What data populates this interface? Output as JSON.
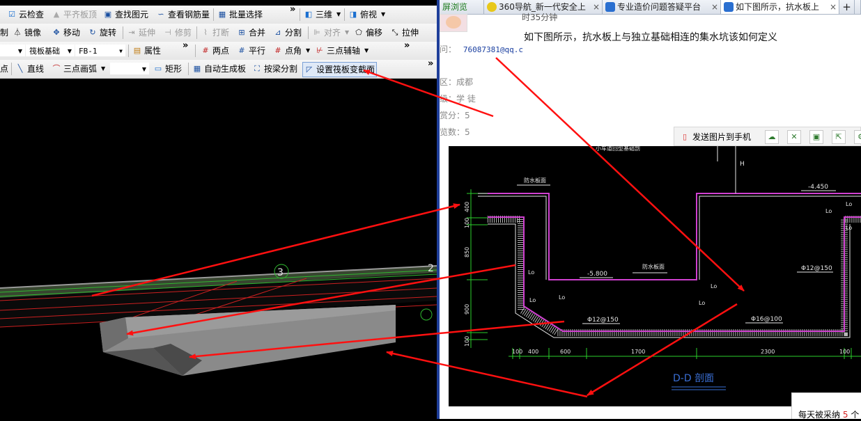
{
  "left_app": {
    "toolbar1": {
      "cloud_check": "云检查",
      "align_top": "平齐板顶",
      "find_element": "查找图元",
      "view_rebar": "查看钢筋量",
      "batch_select": "批量选择",
      "three_d": "三维",
      "top_view": "俯视"
    },
    "toolbar2": {
      "copy_partial": "制",
      "mirror": "镜像",
      "move": "移动",
      "rotate": "旋转",
      "extend": "延伸",
      "trim": "修剪",
      "break": "打断",
      "merge": "合并",
      "split": "分割",
      "align": "对齐",
      "offset": "偏移",
      "stretch": "拉伸"
    },
    "toolbar3": {
      "category_value": "筏板基础",
      "element_value": "FB-1",
      "properties": "属性",
      "two_points": "两点",
      "parallel": "平行",
      "point_angle": "点角",
      "three_point_axis": "三点辅轴"
    },
    "toolbar4": {
      "point_partial": "点",
      "line": "直线",
      "three_point_arc": "三点画弧",
      "rectangle": "矩形",
      "auto_generate": "自动生成板",
      "split_by_beam": "按梁分割",
      "set_slope": "设置筏板变截面"
    },
    "viewport": {
      "axis_label_3": "3",
      "axis_label_2": "2"
    }
  },
  "browser": {
    "tabs": [
      {
        "label": "屏浏览"
      },
      {
        "label": "360导航_新一代安全上"
      },
      {
        "label": "专业造价问题答疑平台"
      },
      {
        "label": "如下图所示，抗水板上"
      }
    ],
    "question_time": "时35分钟",
    "question_text": "如下图所示，抗水板上与独立基础相连的集水坑该如何定义",
    "qq_label": "问：",
    "qq_value": "76087381@qq.c",
    "region_label": "区：成都",
    "level_label": "级：学 徒",
    "reward_label": "赏分：5",
    "views_label": "览数：5",
    "send_to_phone": "发送图片到手机",
    "footer_text": "每天被采纳",
    "footer_count": "5",
    "footer_unit": "个"
  },
  "cad": {
    "top_partial": "小车道回型基础剖",
    "waterproof_left": "防水板面",
    "waterproof_mid": "防水板面",
    "elev_top": "-4.450",
    "elev_bottom": "-5.800",
    "la_labels": [
      "Lo",
      "Lo",
      "Lo",
      "Lo",
      "Lo",
      "Lo",
      "Lo",
      "Lo"
    ],
    "rebar_1": "Φ12@150",
    "rebar_2": "Φ12@150",
    "rebar_3": "Φ16@100",
    "dim_vertical": [
      "400",
      "100",
      "850",
      "900",
      "100"
    ],
    "dim_horizontal": [
      "100",
      "400",
      "600",
      "1700",
      "2300",
      "100"
    ],
    "section_title": "D-D 剖面",
    "mark_h": "H"
  },
  "colors": {
    "arrow": "#ff1010",
    "splitter": "#1f3f9a",
    "cad_magenta": "#d040d0",
    "cad_green": "#2bd02b",
    "cad_title": "#3a6fd6"
  }
}
